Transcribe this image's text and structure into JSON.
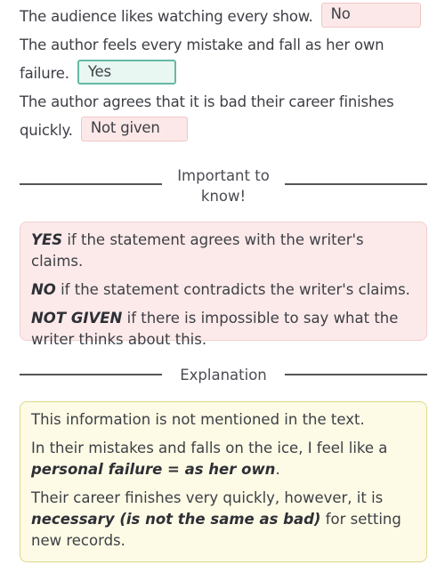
{
  "questions": [
    {
      "text": "The audience likes watching every show.",
      "answer": "No",
      "status": "wrong"
    },
    {
      "text": "The author feels every mistake and fall as her own failure.",
      "answer": "Yes",
      "status": "correct"
    },
    {
      "text": "The author agrees that it is bad their career finishes quickly.",
      "answer": "Not given",
      "status": "wrong"
    }
  ],
  "important": {
    "heading": "Important to know!",
    "rules": [
      {
        "keyword": "YES",
        "text": " if the statement agrees with the writer's claims."
      },
      {
        "keyword": "NO",
        "text": " if the statement contradicts the writer's claims."
      },
      {
        "keyword": "NOT GIVEN",
        "text": " if there is impossible to say what the writer thinks about this."
      }
    ]
  },
  "explanation": {
    "heading": "Explanation",
    "p1": "This information is not mentioned in the text.",
    "p2_before": "In their mistakes and falls on the ice, I feel like a ",
    "p2_bold": "personal failure = as her own",
    "p2_after": ".",
    "p3_before": "Their career finishes very quickly, however, it is ",
    "p3_bold": "necessary (is not the same as bad)",
    "p3_after": " for setting new records."
  },
  "colors": {
    "wrong_bg": "#fce8e8",
    "correct_border": "#64b9a4",
    "info_bg": "#fceaea",
    "explanation_bg": "#fdfbe6"
  }
}
